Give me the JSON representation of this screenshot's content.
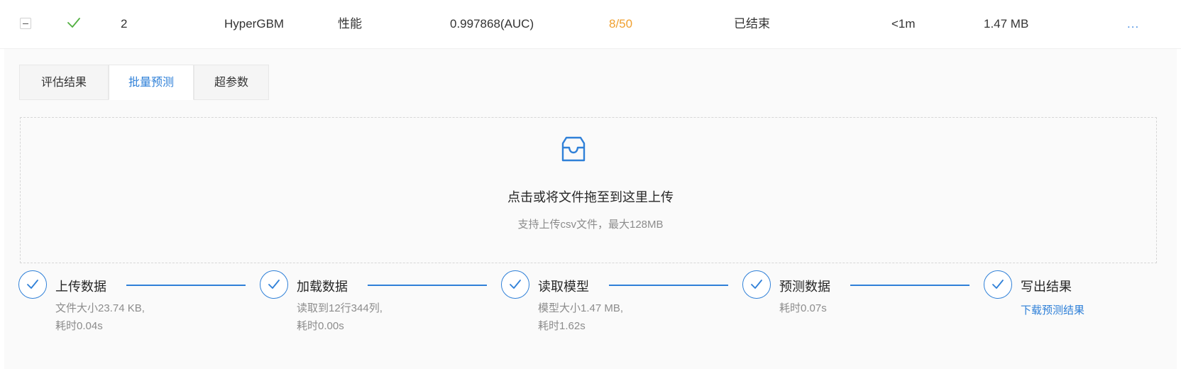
{
  "row": {
    "index": "2",
    "framework": "HyperGBM",
    "mode": "性能",
    "score": "0.997868(AUC)",
    "trials": "8/50",
    "status": "已结束",
    "duration": "<1m",
    "size": "1.47 MB",
    "more": "...",
    "status_icon": "check-icon",
    "accent_color": "#f0a030"
  },
  "tabs": [
    {
      "label": "评估结果"
    },
    {
      "label": "批量预测"
    },
    {
      "label": "超参数"
    }
  ],
  "active_tab": 1,
  "upload": {
    "icon": "inbox-icon",
    "text": "点击或将文件拖至到这里上传",
    "hint": "支持上传csv文件，最大128MB"
  },
  "steps": [
    {
      "title": "上传数据",
      "desc1": "文件大小23.74 KB,",
      "desc2": "耗时0.04s"
    },
    {
      "title": "加载数据",
      "desc1": "读取到12行344列,",
      "desc2": "耗时0.00s"
    },
    {
      "title": "读取模型",
      "desc1": "模型大小1.47 MB,",
      "desc2": "耗时1.62s"
    },
    {
      "title": "预测数据",
      "desc1": "耗时0.07s"
    },
    {
      "title": "写出结果",
      "link": "下载预测结果"
    }
  ],
  "primary_color": "#2f80d8"
}
